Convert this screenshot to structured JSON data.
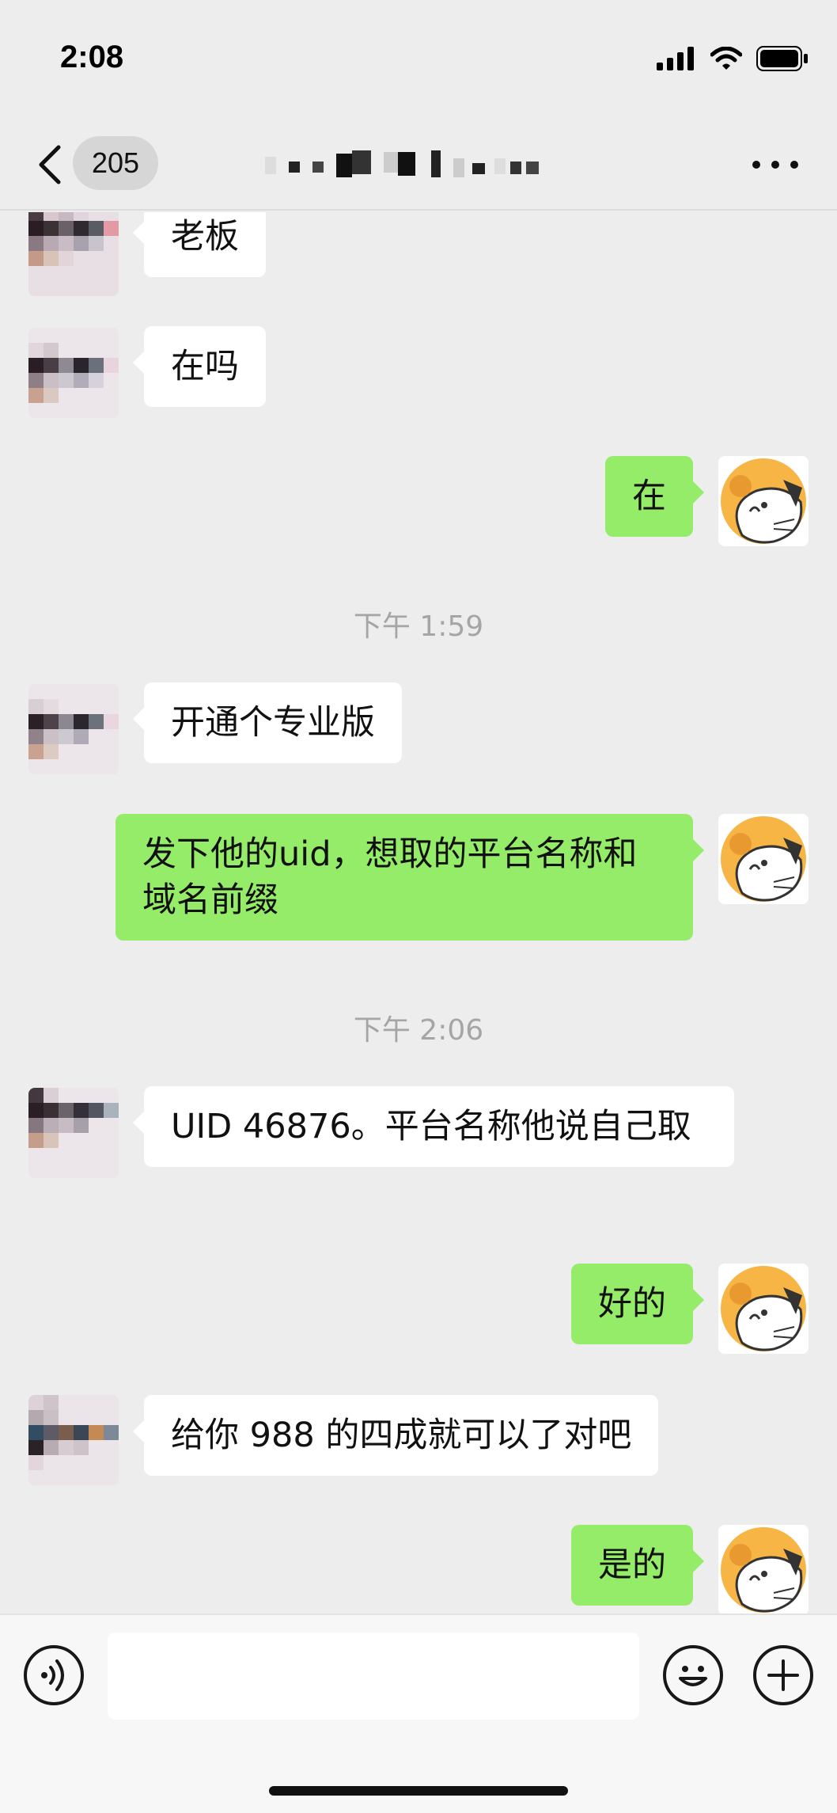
{
  "status_bar": {
    "time": "2:08"
  },
  "nav": {
    "unread_count": "205"
  },
  "messages": [
    {
      "from": "other",
      "text": "老板"
    },
    {
      "from": "other",
      "text": "在吗"
    },
    {
      "from": "me",
      "text": "在"
    },
    {
      "type": "time",
      "text": "下午 1:59"
    },
    {
      "from": "other",
      "text": "开通个专业版"
    },
    {
      "from": "me",
      "text": "发下他的uid，想取的平台名称和域名前缀"
    },
    {
      "type": "time",
      "text": "下午 2:06"
    },
    {
      "from": "other",
      "text": "UID 46876。平台名称他说自己取"
    },
    {
      "from": "me",
      "text": "好的"
    },
    {
      "from": "other",
      "text": "给你 988 的四成就可以了对吧"
    },
    {
      "from": "me",
      "text": "是的"
    }
  ],
  "colors": {
    "background": "#ededed",
    "bubble_in": "#ffffff",
    "bubble_out": "#95ec69",
    "timestamp_text": "#a5a5a5"
  },
  "icons": {
    "back": "chevron-left-icon",
    "more": "more-dots-icon",
    "voice": "voice-icon",
    "emoji": "emoji-icon",
    "plus": "plus-icon"
  }
}
